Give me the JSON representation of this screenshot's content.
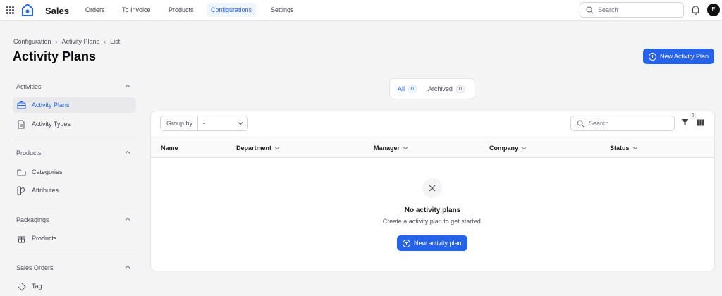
{
  "app": {
    "name": "Sales",
    "user_initial": "E"
  },
  "nav": [
    {
      "label": "Orders",
      "active": false
    },
    {
      "label": "To Invoice",
      "active": false
    },
    {
      "label": "Products",
      "active": false
    },
    {
      "label": "Configurations",
      "active": true
    },
    {
      "label": "Settings",
      "active": false
    }
  ],
  "top_search": {
    "placeholder": "Search"
  },
  "breadcrumb": [
    "Configuration",
    "Activity Plans",
    "List"
  ],
  "page_title": "Activity Plans",
  "new_button_label": "New Activity Plan",
  "sidebar": {
    "groups": [
      {
        "label": "Activities",
        "items": [
          {
            "label": "Activity Plans",
            "icon": "briefcase-icon",
            "active": true
          },
          {
            "label": "Activity Types",
            "icon": "document-icon",
            "active": false
          }
        ]
      },
      {
        "label": "Products",
        "items": [
          {
            "label": "Categories",
            "icon": "folder-icon",
            "active": false
          },
          {
            "label": "Attributes",
            "icon": "swatch-icon",
            "active": false
          }
        ]
      },
      {
        "label": "Packagings",
        "items": [
          {
            "label": "Products",
            "icon": "gift-icon",
            "active": false
          }
        ]
      },
      {
        "label": "Sales Orders",
        "items": [
          {
            "label": "Tag",
            "icon": "tag-icon",
            "active": false
          }
        ]
      }
    ]
  },
  "tabs": [
    {
      "label": "All",
      "count": "0",
      "active": true
    },
    {
      "label": "Archived",
      "count": "0",
      "active": false
    }
  ],
  "table": {
    "group_by_label": "Group by",
    "group_by_value": "-",
    "search_placeholder": "Search",
    "filter_count": "0",
    "columns": [
      "Name",
      "Department",
      "Manager",
      "Company",
      "Status"
    ]
  },
  "empty_state": {
    "title": "No activity plans",
    "subtitle": "Create a activity plan to get started.",
    "button_label": "New activity plan"
  },
  "colors": {
    "accent": "#2563eb",
    "background": "#f4f4f5"
  }
}
